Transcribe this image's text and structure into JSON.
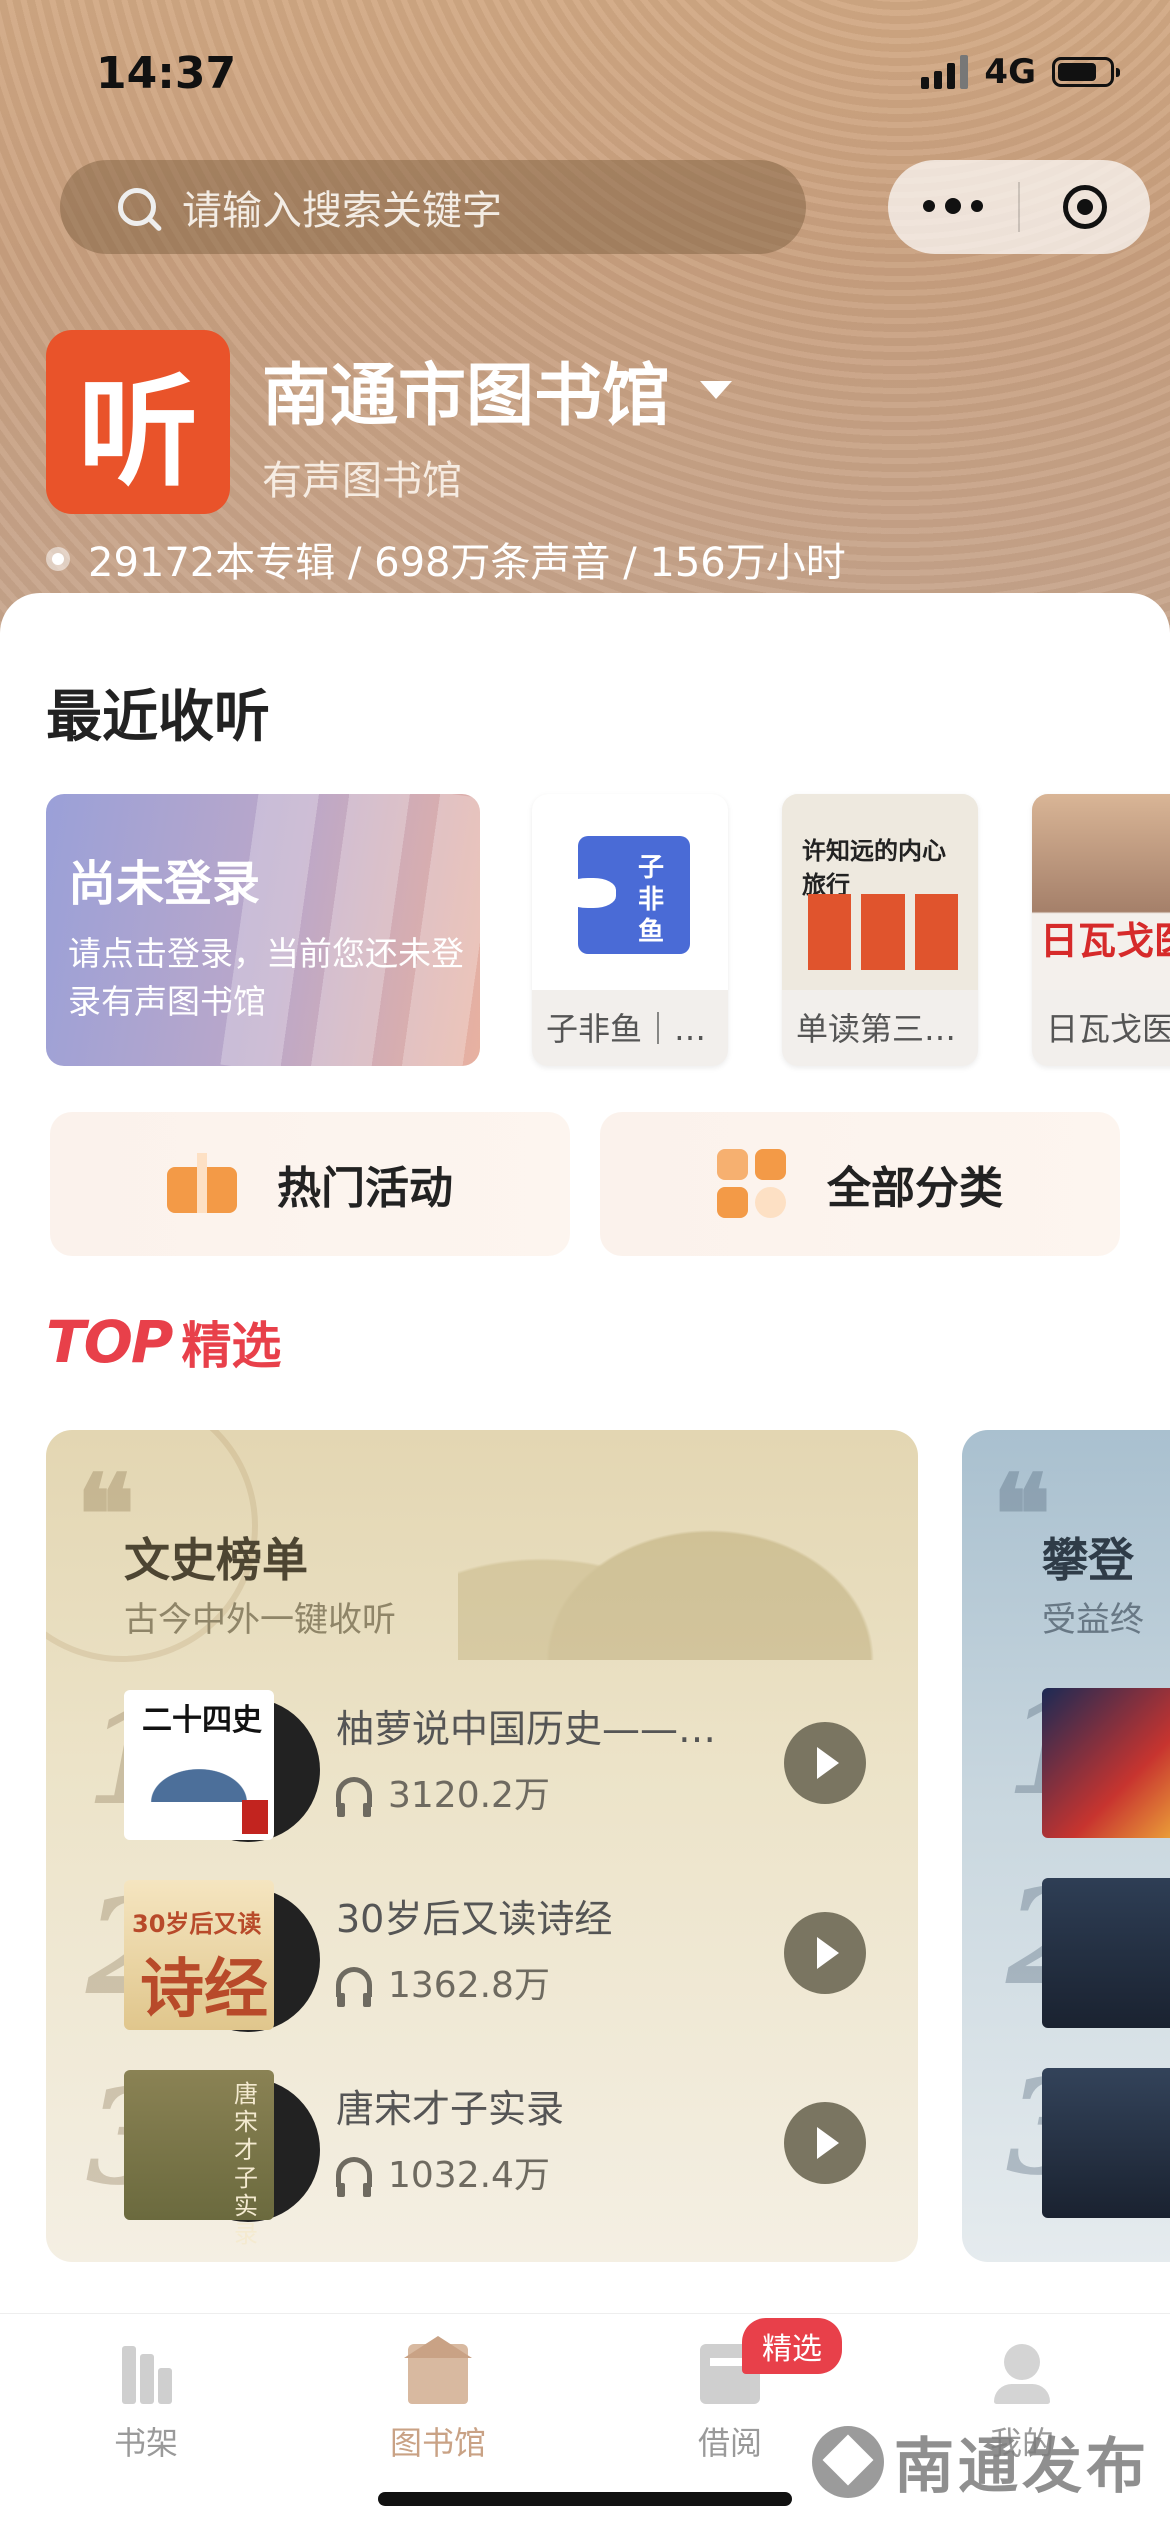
{
  "status_bar": {
    "time": "14:37",
    "network": "4G"
  },
  "search": {
    "placeholder": "请输入搜索关键字"
  },
  "library": {
    "logo_char": "听",
    "name": "南通市图书馆",
    "subtitle": "有声图书馆",
    "stats": "29172本专辑 / 698万条声音 / 156万小时"
  },
  "recent": {
    "title": "最近收听",
    "login_card": {
      "title": "尚未登录",
      "subtitle": "请点击登录，当前您还未登录有声图书馆"
    },
    "items": [
      {
        "title": "子非鱼｜…",
        "cover_text": "子非鱼"
      },
      {
        "title": "单读第三…",
        "cover_text": "许知远的内心旅行"
      },
      {
        "title": "日瓦戈医",
        "cover_text": "日瓦戈医"
      }
    ]
  },
  "actions": {
    "hot": "热门活动",
    "categories": "全部分类"
  },
  "top": {
    "logo": "TOP",
    "title": "精选",
    "rankings": [
      {
        "title": "文史榜单",
        "subtitle": "古今中外一键收听",
        "items": [
          {
            "rank": "1",
            "name": "柚萝说中国历史——…",
            "plays": "3120.2万",
            "cover_text": "二十四史"
          },
          {
            "rank": "2",
            "name": "30岁后又读诗经",
            "plays": "1362.8万",
            "cover_text": "30岁后又读",
            "cover_big": "诗经"
          },
          {
            "rank": "3",
            "name": "唐宋才子实录",
            "plays": "1032.4万",
            "cover_text": "唐宋才子实录"
          }
        ]
      },
      {
        "title": "攀登",
        "subtitle": "受益终",
        "items": [
          {
            "rank": "1"
          },
          {
            "rank": "2"
          },
          {
            "rank": "3"
          }
        ]
      }
    ]
  },
  "tabbar": {
    "items": [
      {
        "label": "书架"
      },
      {
        "label": "图书馆"
      },
      {
        "label": "借阅"
      },
      {
        "label": "我的"
      }
    ],
    "badge": "精选"
  },
  "watermark": "南通发布"
}
